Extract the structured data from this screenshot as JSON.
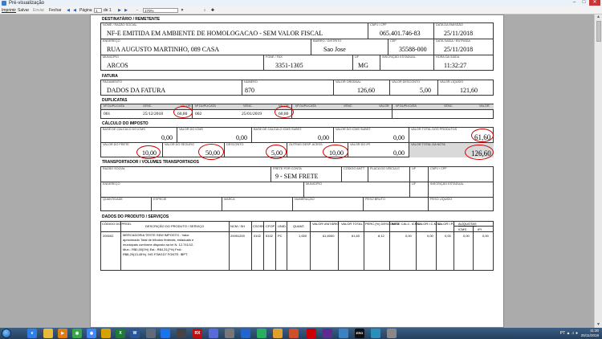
{
  "window": {
    "title": "Pré-visualização"
  },
  "toolbar": {
    "print": "Imprimir",
    "save": "Salvar",
    "send": "Enviar",
    "close": "Fechar",
    "page_label": "Página",
    "page_value": "1",
    "page_total": "de 1",
    "zoom": "170%"
  },
  "danfe": {
    "destinatario": {
      "section": "DESTINATÁRIO / REMETENTE",
      "nome_label": "NOME / RAZÃO SOCIAL",
      "nome": "NF-E EMITIDA EM AMBIENTE DE HOMOLOGACAO - SEM VALOR FISCAL",
      "cnpj_label": "CNPJ / CPF",
      "cnpj": "065.401.746-83",
      "data_emissao_label": "DATA DA EMISSÃO",
      "data_emissao": "25/11/2018",
      "endereco_label": "ENDEREÇO",
      "endereco": "RUA AUGUSTO MARTINHO, 089 CASA",
      "bairro_label": "BAIRRO / DISTRITO",
      "bairro": "Sao Jose",
      "cep_label": "CEP",
      "cep": "35588-000",
      "data_saida_label": "DATA SAÍDA / ENTRADA",
      "data_saida": "25/11/2018",
      "municipio_label": "MUNICÍPIO",
      "municipio": "ARCOS",
      "fone_label": "FONE / FAX",
      "fone": "3351-1305",
      "uf_label": "UF",
      "uf": "MG",
      "ie_label": "INSCRIÇÃO ESTADUAL",
      "ie": "",
      "hora_saida_label": "HORA DA SAÍDA",
      "hora_saida": "11:32:27"
    },
    "fatura": {
      "section": "FATURA",
      "pagamento_label": "PAGAMENTO",
      "pagamento": "DADOS DA FATURA",
      "numero_label": "NÚMERO",
      "numero": "870",
      "valor_original_label": "VALOR ORIGINAL",
      "valor_original": "126,60",
      "valor_desconto_label": "VALOR DESCONTO",
      "valor_desconto": "5,00",
      "valor_liquido_label": "VALOR LÍQUIDO",
      "valor_liquido": "121,60"
    },
    "duplicatas": {
      "section": "DUPLICATAS",
      "h_dup": "Nº DUPLICATA",
      "h_venc": "VENC.",
      "h_valor": "VALOR",
      "items": [
        {
          "num": "001",
          "venc": "25/12/2018",
          "valor": "60,80"
        },
        {
          "num": "002",
          "venc": "25/01/2019",
          "valor": "60,80"
        }
      ]
    },
    "imposto": {
      "section": "CÁLCULO DO IMPOSTO",
      "bc_icms_label": "BASE DE CÁLCULO DO ICMS",
      "bc_icms": "0,00",
      "v_icms_label": "VALOR DO ICMS",
      "v_icms": "0,00",
      "bc_st_label": "BASE DE CÁLCULO ICMS SUBST.",
      "bc_st": "0,00",
      "v_st_label": "VALOR DO ICMS SUBST.",
      "v_st": "0,00",
      "v_prod_label": "VALOR TOTAL DOS PRODUTOS",
      "v_prod": "61,60",
      "frete_label": "VALOR DO FRETE",
      "frete": "10,00",
      "seguro_label": "VALOR DO SEGURO",
      "seguro": "50,00",
      "desconto_label": "DESCONTO",
      "desconto": "5,00",
      "outras_label": "OUTRAS DESP. ACESS.",
      "outras": "10,00",
      "ipi_label": "VALOR DO IPI",
      "ipi": "0,00",
      "v_nota_label": "VALOR TOTAL DA NOTA",
      "v_nota": "126,60"
    },
    "transportador": {
      "section": "TRANSPORTADOR / VOLUMES TRANSPORTADOS",
      "razao_label": "RAZÃO SOCIAL",
      "frete_label": "FRETE POR CONTA",
      "frete": "9 - SEM FRETE",
      "antt_label": "CÓDIGO ANTT",
      "placa_label": "PLACA DO VEÍCULO",
      "uf_label": "UF",
      "cnpj_label": "CNPJ / CPF",
      "endereco_label": "ENDEREÇO",
      "municipio_label": "MUNICÍPIO",
      "ie_label": "INSCRIÇÃO ESTADUAL",
      "qtd_label": "QUANTIDADE",
      "especie_label": "ESPÉCIE",
      "marca_label": "MARCA",
      "numeracao_label": "NUMERAÇÃO",
      "pb_label": "PESO BRUTO",
      "pl_label": "PESO LÍQUIDO"
    },
    "produtos": {
      "section": "DADOS DO PRODUTO / SERVIÇOS",
      "headers": [
        "CÓDIGO DO PROD.",
        "DESCRIÇÃO DO PRODUTO / SERVIÇO",
        "NCM / SH",
        "CSOSN",
        "CFOP",
        "UNID.",
        "QUANT.",
        "VALOR UNITÁRIO",
        "VALOR TOTAL",
        "PERC.(%) DESCONTO",
        "BASE CÁLC. ICMS",
        "VALOR I.C.M.S.",
        "VALOR I.P.I.",
        "ALÍQUOTAS",
        "ICMS",
        "IPI"
      ],
      "row": {
        "codigo": "200002",
        "descricao": [
          "MERCADORIA TESTE SEM IMPOSTO - Valor",
          "aproximado Total de tributos federais, estaduais e",
          "municipais conforme disposto na lei N. 12.741/12.",
          "Mun.: R$0,00(0%) Est.: R$4,31(7%) Fed.:",
          "R$8,29(13,45%). MG F3W1D7 FONTE: IBPT."
        ],
        "ncm": "20091200",
        "csosn": "0102",
        "cfop": "5102",
        "unid": "PC",
        "quant": "1,000",
        "v_unit": "61,6000",
        "v_total": "61,60",
        "perc_desc": "8,12",
        "bc_icms": "0,00",
        "v_icms": "0,00",
        "v_ipi": "0,00",
        "aliq_icms": "0,00",
        "aliq_ipi": "0,00"
      }
    }
  },
  "taskbar": {
    "time": "11:30",
    "date": "25/11/2018",
    "lang": "PT",
    "app_label": "ERG"
  }
}
